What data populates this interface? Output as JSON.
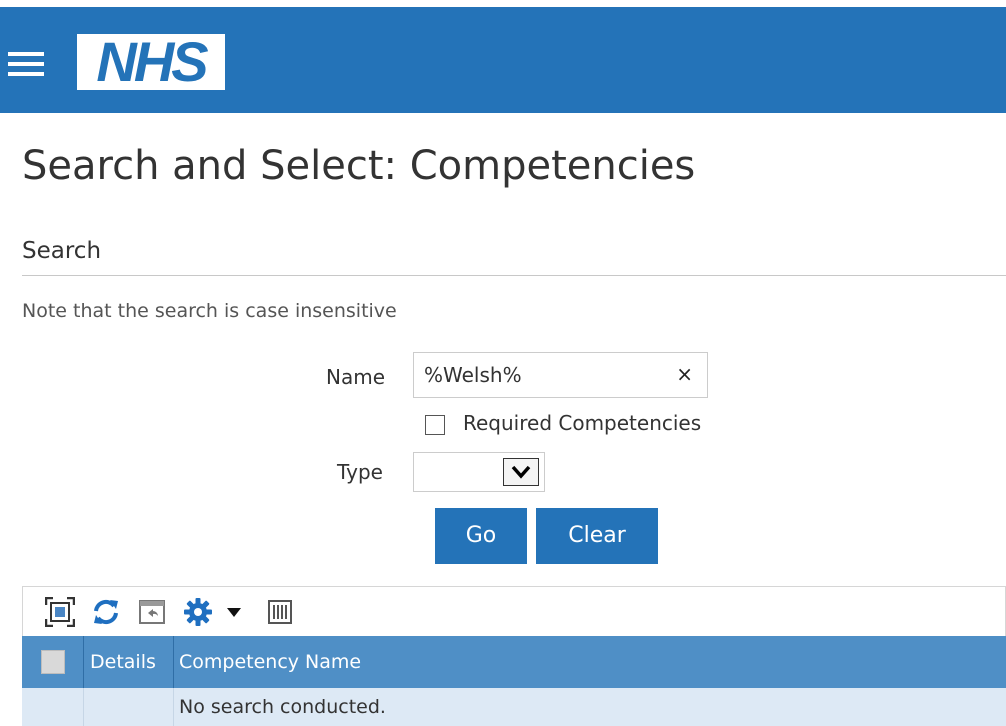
{
  "header": {
    "logo_text": "NHS",
    "brand_color": "#2473b8"
  },
  "page": {
    "title": "Search and Select: Competencies"
  },
  "search": {
    "section_title": "Search",
    "note": "Note that the search is case insensitive",
    "name_label": "Name",
    "name_value": "%Welsh%",
    "clear_glyph": "×",
    "required_label": "Required Competencies",
    "required_checked": false,
    "type_label": "Type",
    "type_value": "",
    "go_label": "Go",
    "clear_label": "Clear"
  },
  "toolbar": {
    "icons": [
      "detach-icon",
      "refresh-icon",
      "undo-icon",
      "settings-icon",
      "columns-icon"
    ]
  },
  "table": {
    "columns": [
      "",
      "Details",
      "Competency Name"
    ],
    "empty_message": "No search conducted.",
    "header_color": "#4f8fc6",
    "row_color": "#dde9f5"
  }
}
